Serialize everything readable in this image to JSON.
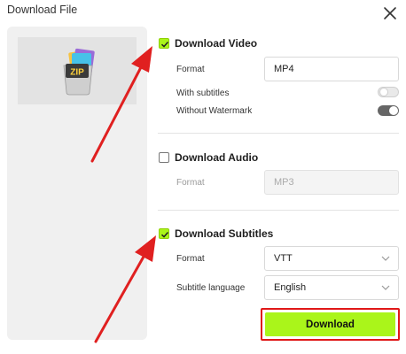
{
  "dialog": {
    "title": "Download File",
    "close_icon": "close-icon"
  },
  "preview": {
    "icon": "zip-archive-icon",
    "icon_text": "ZIP"
  },
  "video": {
    "label": "Download Video",
    "checked": true,
    "format_label": "Format",
    "format_value": "MP4",
    "subtitles_label": "With subtitles",
    "subtitles_on": false,
    "watermark_label": "Without Watermark",
    "watermark_on": true
  },
  "audio": {
    "label": "Download Audio",
    "checked": false,
    "format_label": "Format",
    "format_value": "MP3"
  },
  "subtitles": {
    "label": "Download Subtitles",
    "checked": true,
    "format_label": "Format",
    "format_value": "VTT",
    "language_label": "Subtitle language",
    "language_value": "English"
  },
  "actions": {
    "download_label": "Download"
  },
  "colors": {
    "accent": "#aaf51a",
    "highlight_border": "#e01818",
    "annotation_arrow": "#e02020"
  }
}
